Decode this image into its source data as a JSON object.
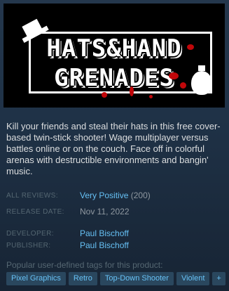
{
  "capsule": {
    "logo_line_1": "HATS&HAND",
    "logo_line_2": "GRENADES"
  },
  "description": "Kill your friends and steal their hats in this free cover-based twin-stick shooter! Wage multiplayer versus battles online or on the couch. Face off in colorful arenas with destructible environments and bangin' music.",
  "reviews": {
    "label": "ALL REVIEWS:",
    "summary": "Very Positive",
    "count": "(200)"
  },
  "release": {
    "label": "RELEASE DATE:",
    "value": "Nov 11, 2022"
  },
  "developer": {
    "label": "DEVELOPER:",
    "value": "Paul Bischoff"
  },
  "publisher": {
    "label": "PUBLISHER:",
    "value": "Paul Bischoff"
  },
  "tags": {
    "heading": "Popular user-defined tags for this product:",
    "items": [
      "Pixel Graphics",
      "Retro",
      "Top-Down Shooter",
      "Violent"
    ],
    "more": "+"
  },
  "colors": {
    "background": "#1b2838",
    "link": "#66c0f4",
    "tag_bg": "#2a475e",
    "blood": "#c0070a"
  },
  "icons": [
    "hat-icon",
    "grenade-icon"
  ]
}
